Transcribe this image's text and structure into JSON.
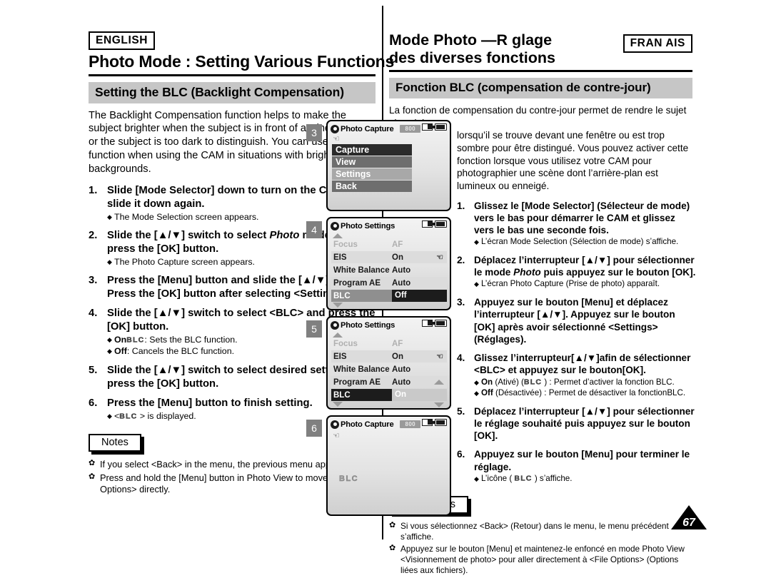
{
  "page_number": "67",
  "english": {
    "language_badge": "ENGLISH",
    "chapter_title": "Photo Mode : Setting Various Functions",
    "section_title": "Setting the BLC (Backlight Compensation)",
    "intro": "The Backlight Compensation function helps to make the subject brighter when the subject is in front of a window or the subject is too dark to distinguish. You can use this function when using the CAM in situations with bright backgrounds.",
    "steps": [
      {
        "num": "1.",
        "text": "Slide [Mode Selector] down to turn on the CAM and slide it down again.",
        "bullets": [
          {
            "prefix": "",
            "text": "The Mode Selection screen appears."
          }
        ]
      },
      {
        "num": "2.",
        "text_a": "Slide the [▲/▼] switch to select ",
        "text_italic": "Photo",
        "text_b": " mode and press the [OK] button.",
        "bullets": [
          {
            "prefix": "",
            "text": "The Photo Capture screen appears."
          }
        ]
      },
      {
        "num": "3.",
        "text": "Press the [Menu] button and slide the [▲/▼] switch.\nPress the [OK] button after selecting <Settings>.",
        "bullets": []
      },
      {
        "num": "4.",
        "text": "Slide the [▲/▼] switch to select <BLC> and press the [OK] button.",
        "bullets": [
          {
            "prefix": "On",
            "icon": "BLC",
            "text": ": Sets the BLC function."
          },
          {
            "prefix": "Off",
            "text": ": Cancels the BLC function."
          }
        ]
      },
      {
        "num": "5.",
        "text": "Slide the [▲/▼] switch to select desired setting and press the [OK] button.",
        "bullets": []
      },
      {
        "num": "6.",
        "text": "Press the [Menu] button to finish setting.",
        "bullets": [
          {
            "prefix": "",
            "icon": "BLC",
            "text": " > is displayed.",
            "pre_icon": "<"
          }
        ]
      }
    ],
    "notes_label": "Notes",
    "notes": [
      "If you select <Back> in the menu, the previous menu appears.",
      "Press and hold the [Menu] button in Photo View to move to <File Options> directly."
    ]
  },
  "french": {
    "language_badge": "FRAN AIS",
    "chapter_title_line1": "Mode Photo —R glage",
    "chapter_title_line2": "des diverses fonctions",
    "section_title": "Fonction BLC (compensation de contre-jour)",
    "intro_first_line": "La fonction de compensation du contre-jour permet de rendre le sujet plus clair",
    "intro_rest": "lorsqu’il se trouve devant une fenêtre ou est trop sombre pour être distingué. Vous pouvez activer cette fonction lorsque vous utilisez votre CAM pour photographier une scène dont l’arrière-plan est lumineux ou enneigé.",
    "steps": [
      {
        "num": "1.",
        "text": "Glissez le [Mode Selector] (Sélecteur de mode) vers le bas pour démarrer le CAM et glissez vers le bas une seconde fois.",
        "bullets": [
          {
            "prefix": "",
            "text": "L’écran Mode Selection (Sélection de mode) s’affiche."
          }
        ]
      },
      {
        "num": "2.",
        "text_a": "Déplacez l’interrupteur [▲/▼] pour sélectionner le mode ",
        "text_italic": "Photo",
        "text_b": " puis appuyez sur le bouton [OK].",
        "bullets": [
          {
            "prefix": "",
            "text": "L’écran Photo Capture (Prise de photo) apparaît."
          }
        ]
      },
      {
        "num": "3.",
        "text": "Appuyez sur le bouton [Menu] et déplacez l’interrupteur [▲/▼]. Appuyez sur le bouton [OK] après avoir sélectionné <Settings> (Réglages).",
        "bullets": []
      },
      {
        "num": "4.",
        "text": "Glissez l’interrupteur[▲/▼]afin de sélectionner <BLC> et appuyez sur le bouton[OK].",
        "bullets": [
          {
            "prefix": "On",
            "mid": " (Ativé) (",
            "icon": "BLC",
            "text": " ) : Permet d’activer la fonction BLC."
          },
          {
            "prefix": "Off",
            "text": " (Désactivée) : Permet de désactiver la fonctionBLC."
          }
        ]
      },
      {
        "num": "5.",
        "text": "Déplacez l’interrupteur [▲/▼] pour sélectionner le réglage souhaité puis appuyez sur le bouton [OK].",
        "bullets": []
      },
      {
        "num": "6.",
        "text": "Appuyez sur le bouton [Menu] pour terminer le réglage.",
        "bullets": [
          {
            "prefix": "",
            "mid": "L’icône ( ",
            "icon": "BLC",
            "text": " ) s’affiche."
          }
        ]
      }
    ],
    "notes_label": "Remarques",
    "notes": [
      "Si vous sélectionnez <Back> (Retour) dans le menu, le menu précédent s’affiche.",
      "Appuyez sur le bouton [Menu] et maintenez-le enfoncé en mode Photo View <Visionnement de photo> pour aller directement à <File Options> (Options liées aux fichiers)."
    ]
  },
  "lcd_panels": [
    {
      "step_badge": "3",
      "title": "Photo Capture",
      "resolution": "800",
      "type": "menu",
      "hand_icon": true,
      "menu_items": [
        {
          "label": "Capture",
          "shade": "dark"
        },
        {
          "label": "View",
          "shade": "mid"
        },
        {
          "label": "Settings",
          "shade": "light"
        },
        {
          "label": "Back",
          "shade": "mid"
        }
      ]
    },
    {
      "step_badge": "4",
      "title": "Photo Settings",
      "resolution": "",
      "type": "settings",
      "rows": [
        {
          "label": "Focus",
          "value": "AF",
          "style": "dim"
        },
        {
          "label": "EIS",
          "value": "On",
          "style": "normal",
          "hand": true
        },
        {
          "label": "White Balance",
          "value": "Auto",
          "style": "normal"
        },
        {
          "label": "Program AE",
          "value": "Auto",
          "style": "normal"
        },
        {
          "label": "BLC",
          "value": "Off",
          "style": "selected-off"
        }
      ],
      "scroll_up": true,
      "scroll_down": true,
      "side_arrows": false
    },
    {
      "step_badge": "5",
      "title": "Photo Settings",
      "resolution": "",
      "type": "settings",
      "rows": [
        {
          "label": "Focus",
          "value": "AF",
          "style": "dim"
        },
        {
          "label": "EIS",
          "value": "On",
          "style": "normal",
          "hand": true
        },
        {
          "label": "White Balance",
          "value": "Auto",
          "style": "normal"
        },
        {
          "label": "Program AE",
          "value": "Auto",
          "style": "normal"
        },
        {
          "label": "BLC",
          "value": "On",
          "style": "selected-on"
        }
      ],
      "scroll_up": true,
      "scroll_down": true,
      "side_arrows": true
    },
    {
      "step_badge": "6",
      "title": "Photo Capture",
      "resolution": "800",
      "type": "capture",
      "hand_icon": true,
      "watermark": "BLC"
    }
  ]
}
